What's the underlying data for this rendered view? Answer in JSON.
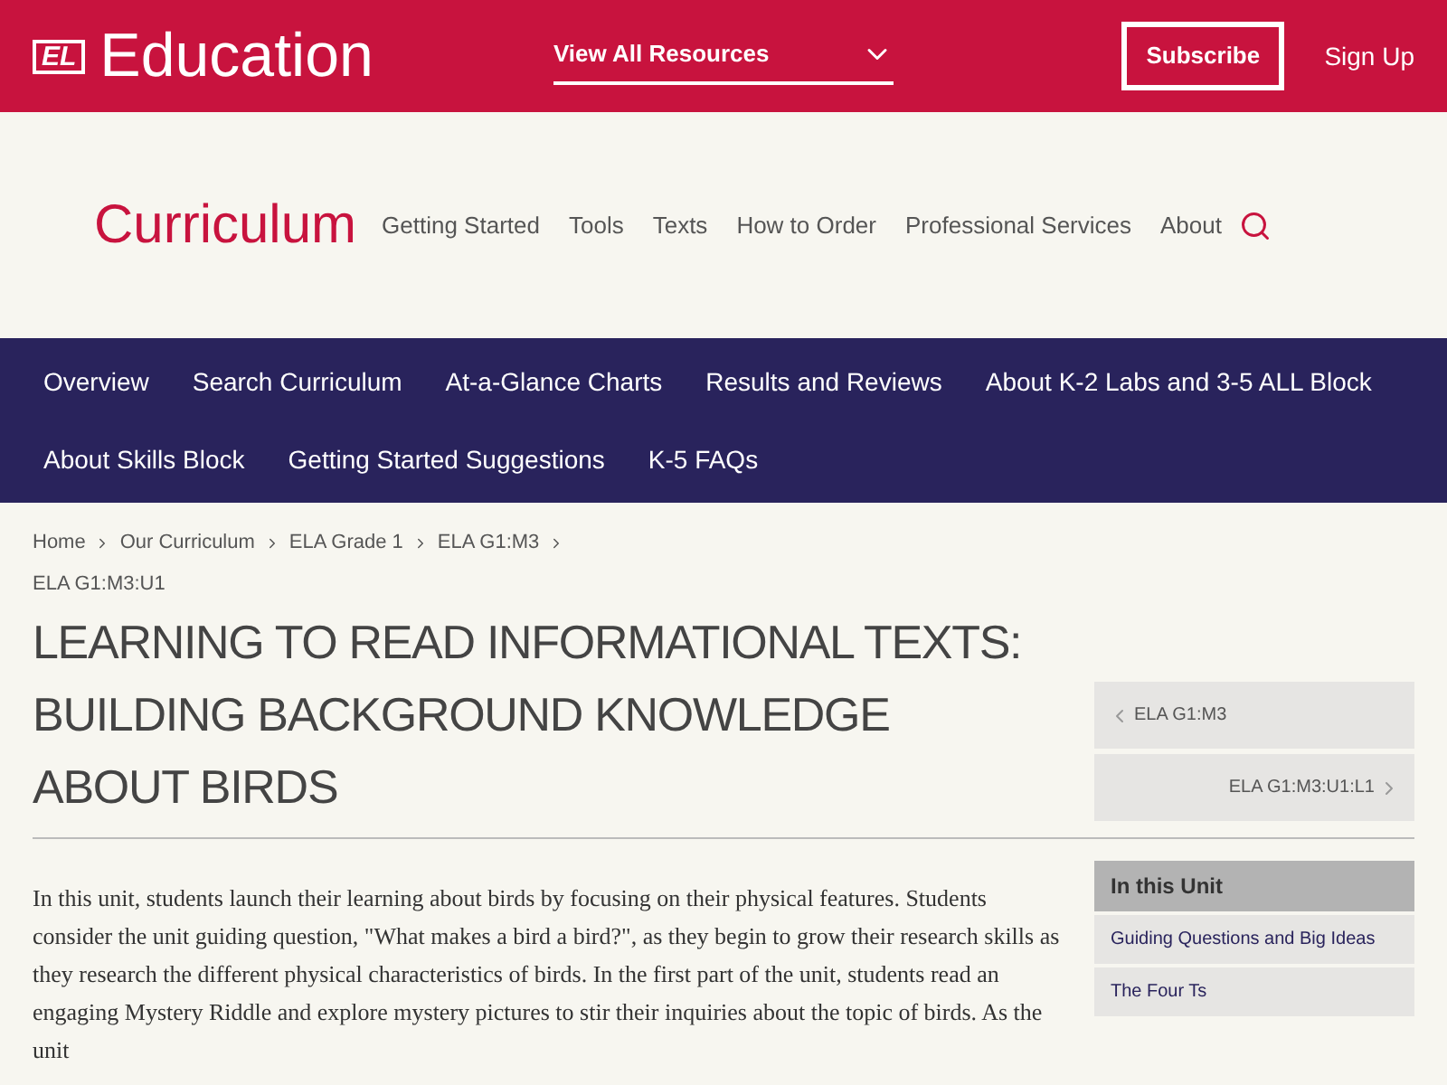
{
  "top_bar": {
    "logo_mark": "EL",
    "logo_text": "Education",
    "resources_dropdown": "View All Resources",
    "subscribe": "Subscribe",
    "sign_up": "Sign Up"
  },
  "header": {
    "title": "Curriculum",
    "links": [
      "Getting Started",
      "Tools",
      "Texts",
      "How to Order",
      "Professional Services",
      "About"
    ]
  },
  "nav": {
    "rows": [
      [
        "Overview",
        "Search Curriculum",
        "At-a-Glance Charts",
        "Results and Reviews",
        "About K-2 Labs and 3-5 ALL Block"
      ],
      [
        "About Skills Block",
        "Getting Started Suggestions",
        "K-5 FAQs"
      ]
    ]
  },
  "breadcrumb": [
    "Home",
    "Our Curriculum",
    "ELA Grade 1",
    "ELA G1:M3"
  ],
  "unit_code": "ELA G1:M3:U1",
  "title": "LEARNING TO READ INFORMATIONAL TEXTS: BUILDING BACKGROUND KNOWLEDGE ABOUT BIRDS",
  "pager": {
    "previous": "ELA G1:M3",
    "next": "ELA G1:M3:U1:L1"
  },
  "body": "In this unit, students launch their learning about birds by focusing on their physical features. Students consider the unit guiding question, \"What makes a bird a bird?\", as they begin to grow their research skills as they research the different physical characteristics of birds. In the first part of the unit, students read an engaging Mystery Riddle and explore mystery pictures to stir their inquiries about the topic of birds. As the unit",
  "in_this_unit": {
    "heading": "In this Unit",
    "links": [
      "Guiding Questions and Big Ideas",
      "The Four Ts"
    ]
  }
}
